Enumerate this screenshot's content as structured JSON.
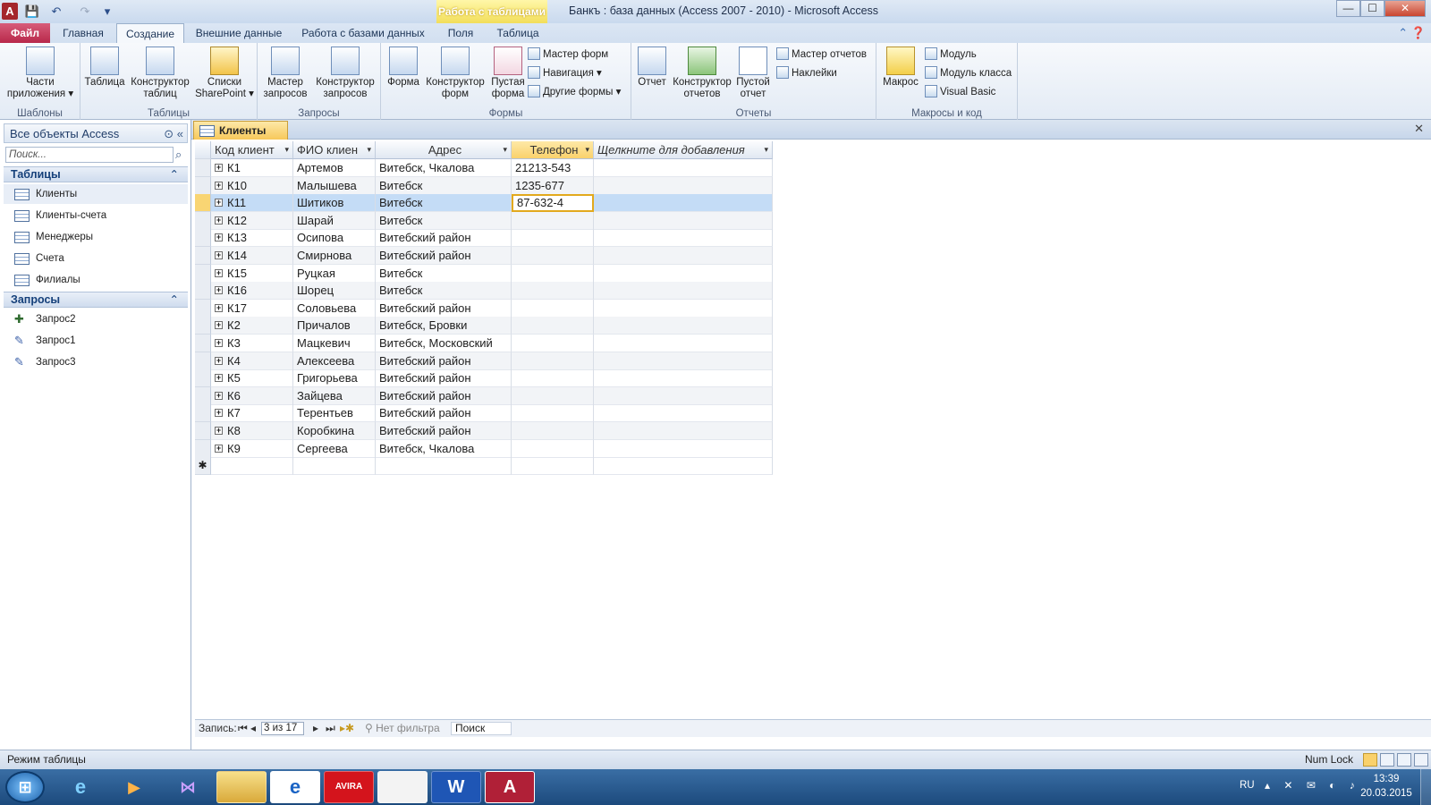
{
  "window": {
    "title": "Банкъ : база данных (Access 2007 - 2010)  -  Microsoft Access",
    "contextual_header": "Работа с таблицами",
    "controls": {
      "minimize": "—",
      "maximize": "☐",
      "close": "✕"
    }
  },
  "quick_access": {
    "app_icon": "A",
    "save": "💾",
    "undo": "↶",
    "redo": "↷",
    "customize": "▾"
  },
  "ribbon_tabs": [
    "Файл",
    "Главная",
    "Создание",
    "Внешние данные",
    "Работа с базами данных",
    "Поля",
    "Таблица"
  ],
  "ribbon_tabs_active": "Создание",
  "ribbon": {
    "groups": {
      "templates": "Шаблоны",
      "tables": "Таблицы",
      "queries": "Запросы",
      "forms": "Формы",
      "reports": "Отчеты",
      "macros": "Макросы и код"
    },
    "templates": {
      "app_parts_1": "Части",
      "app_parts_2": "приложения ▾"
    },
    "tables": {
      "table": "Таблица",
      "designer_1": "Конструктор",
      "designer_2": "таблиц",
      "sharepoint_1": "Списки",
      "sharepoint_2": "SharePoint ▾"
    },
    "queries": {
      "wizard_1": "Мастер",
      "wizard_2": "запросов",
      "designer_1": "Конструктор",
      "designer_2": "запросов"
    },
    "forms": {
      "form": "Форма",
      "designer_1": "Конструктор",
      "designer_2": "форм",
      "blank_1": "Пустая",
      "blank_2": "форма",
      "wizard": "Мастер форм",
      "navigation": "Навигация ▾",
      "other": "Другие формы ▾"
    },
    "reports": {
      "report": "Отчет",
      "designer_1": "Конструктор",
      "designer_2": "отчетов",
      "blank_1": "Пустой",
      "blank_2": "отчет",
      "wizard": "Мастер отчетов",
      "labels": "Наклейки"
    },
    "macros": {
      "macro": "Макрос",
      "module": "Модуль",
      "class_module": "Модуль класса",
      "vb": "Visual Basic"
    }
  },
  "nav": {
    "header": "Все объекты Access",
    "search_placeholder": "Поиск...",
    "tables_title": "Таблицы",
    "tables": [
      "Клиенты",
      "Клиенты-счета",
      "Менеджеры",
      "Счета",
      "Филиалы"
    ],
    "queries_title": "Запросы",
    "queries": [
      "Запрос2",
      "Запрос1",
      "Запрос3"
    ]
  },
  "document": {
    "tab_title": "Клиенты",
    "columns": [
      "Код клиент",
      "ФИО клиен",
      "Адрес",
      "Телефон",
      "Щелкните для добавления"
    ],
    "rows": [
      [
        "К1",
        "Артемов",
        "Витебск, Чкалова",
        "21213-543"
      ],
      [
        "К10",
        "Малышева",
        "Витебск",
        "1235-677"
      ],
      [
        "К11",
        "Шитиков",
        "Витебск",
        "87-632-4"
      ],
      [
        "К12",
        "Шарай",
        "Витебск",
        ""
      ],
      [
        "К13",
        "Осипова",
        "Витебский район",
        ""
      ],
      [
        "К14",
        "Смирнова",
        "Витебский район",
        ""
      ],
      [
        "К15",
        "Руцкая",
        "Витебск",
        ""
      ],
      [
        "К16",
        "Шорец",
        "Витебск",
        ""
      ],
      [
        "К17",
        "Соловьева",
        "Витебский район",
        ""
      ],
      [
        "К2",
        "Причалов",
        "Витебск, Бровки",
        ""
      ],
      [
        "К3",
        "Мацкевич",
        "Витебск, Московский",
        ""
      ],
      [
        "К4",
        "Алексеева",
        "Витебский район",
        ""
      ],
      [
        "К5",
        "Григорьева",
        "Витебский район",
        ""
      ],
      [
        "К6",
        "Зайцева",
        "Витебский район",
        ""
      ],
      [
        "К7",
        "Терентьев",
        "Витебский район",
        ""
      ],
      [
        "К8",
        "Коробкина",
        "Витебский район",
        ""
      ],
      [
        "К9",
        "Сергеева",
        "Витебск, Чкалова",
        ""
      ]
    ],
    "current_row_index": 2,
    "new_row_marker": "✱"
  },
  "record_nav": {
    "label": "Запись:",
    "position": "3 из 17",
    "filter": "Нет фильтра",
    "search": "Поиск"
  },
  "status": {
    "mode": "Режим таблицы",
    "numlock": "Num Lock"
  },
  "taskbar": {
    "apps": [
      "e",
      "▶",
      "⋈",
      "",
      "e",
      "AVIRA",
      "",
      "W",
      "A"
    ],
    "lang": "RU",
    "time": "13:39",
    "date": "20.03.2015"
  },
  "colors": {
    "accent_orange": "#f7c85a",
    "ribbon_blue": "#dbe6f4",
    "file_tab": "#b8284a",
    "selected_row": "#c4dcf6"
  }
}
